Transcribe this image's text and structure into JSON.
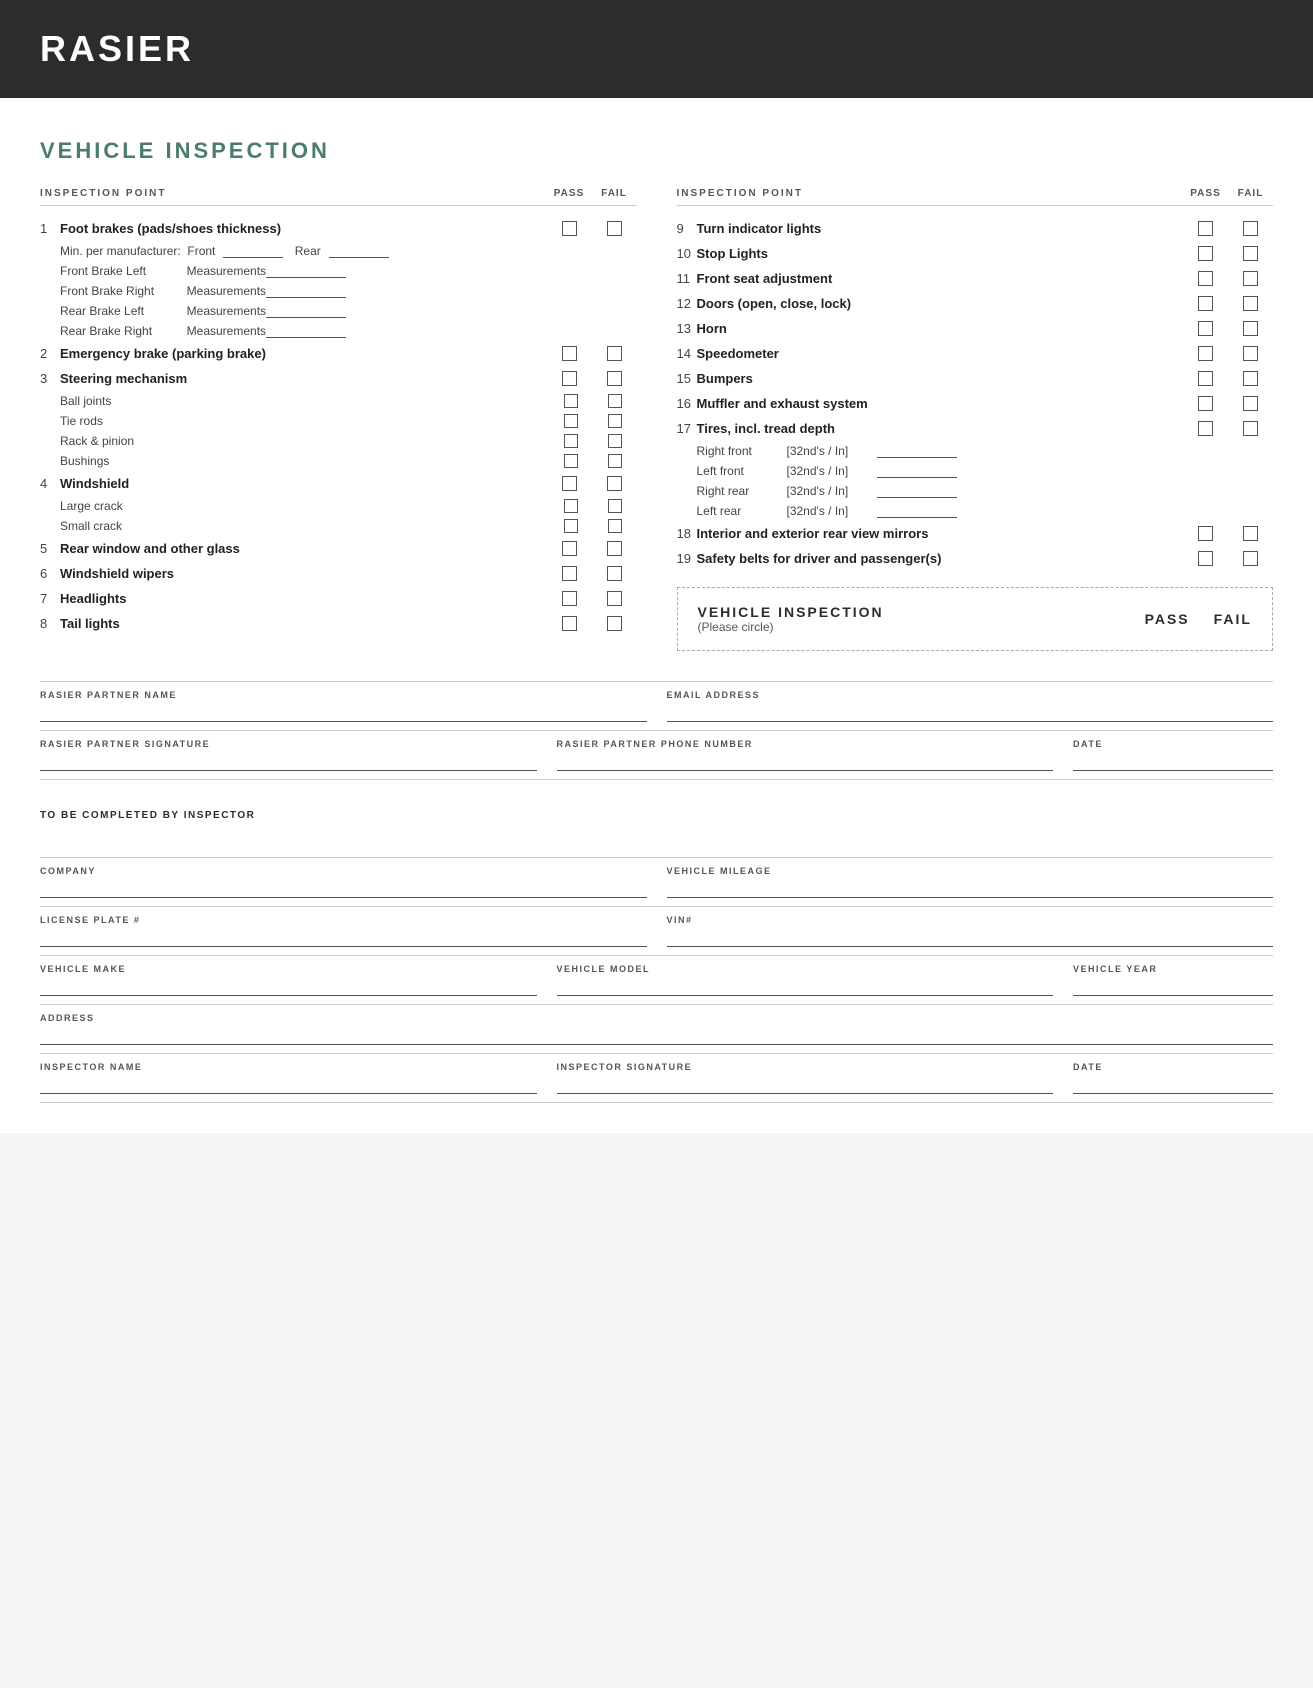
{
  "header": {
    "title": "RASIER"
  },
  "main": {
    "section_title": "VEHICLE INSPECTION",
    "col_headers": {
      "left": {
        "point": "INSPECTION POINT",
        "pass": "PASS",
        "fail": "FAIL"
      },
      "right": {
        "point": "INSPECTION POINT",
        "pass": "PASS",
        "fail": "FAIL"
      }
    },
    "left_items": [
      {
        "num": "1",
        "text": "Foot brakes (pads/shoes thickness)",
        "bold": true,
        "has_checkbox": true,
        "sub": [
          {
            "type": "min_per",
            "text": "Min. per manufacturer:",
            "front_label": "Front",
            "rear_label": "Rear"
          },
          {
            "type": "measurements",
            "label": "Front Brake Left",
            "meas": "Measurements"
          },
          {
            "type": "measurements",
            "label": "Front Brake Right",
            "meas": "Measurements"
          },
          {
            "type": "measurements",
            "label": "Rear Brake Left",
            "meas": "Measurements"
          },
          {
            "type": "measurements",
            "label": "Rear Brake Right",
            "meas": "Measurements"
          }
        ]
      },
      {
        "num": "2",
        "text": "Emergency brake (parking brake)",
        "bold": true,
        "has_checkbox": true
      },
      {
        "num": "3",
        "text": "Steering mechanism",
        "bold": true,
        "has_checkbox": true,
        "sub": [
          {
            "type": "checkbox_sub",
            "label": "Ball joints"
          },
          {
            "type": "checkbox_sub",
            "label": "Tie rods"
          },
          {
            "type": "checkbox_sub",
            "label": "Rack & pinion"
          },
          {
            "type": "checkbox_sub",
            "label": "Bushings"
          }
        ]
      },
      {
        "num": "4",
        "text": "Windshield",
        "bold": true,
        "has_checkbox": true,
        "sub": [
          {
            "type": "checkbox_sub",
            "label": "Large crack"
          },
          {
            "type": "checkbox_sub",
            "label": "Small crack"
          }
        ]
      },
      {
        "num": "5",
        "text": "Rear window and other glass",
        "bold": true,
        "has_checkbox": true
      },
      {
        "num": "6",
        "text": "Windshield wipers",
        "bold": true,
        "has_checkbox": true
      },
      {
        "num": "7",
        "text": "Headlights",
        "bold": true,
        "has_checkbox": true
      },
      {
        "num": "8",
        "text": "Tail lights",
        "bold": true,
        "has_checkbox": true
      }
    ],
    "right_items": [
      {
        "num": "9",
        "text": "Turn indicator lights",
        "bold": true,
        "has_checkbox": true
      },
      {
        "num": "10",
        "text": "Stop Lights",
        "bold": true,
        "has_checkbox": true
      },
      {
        "num": "11",
        "text": "Front seat adjustment",
        "bold": true,
        "has_checkbox": true
      },
      {
        "num": "12",
        "text": "Doors (open, close, lock)",
        "bold": true,
        "has_checkbox": true
      },
      {
        "num": "13",
        "text": "Horn",
        "bold": true,
        "has_checkbox": true
      },
      {
        "num": "14",
        "text": "Speedometer",
        "bold": true,
        "has_checkbox": true
      },
      {
        "num": "15",
        "text": "Bumpers",
        "bold": true,
        "has_checkbox": true
      },
      {
        "num": "16",
        "text": "Muffler and exhaust system",
        "bold": true,
        "has_checkbox": true
      },
      {
        "num": "17",
        "text": "Tires, incl. tread depth",
        "bold": true,
        "has_checkbox": true,
        "sub": [
          {
            "type": "tire",
            "label": "Right front",
            "unit": "[32nd's / In]"
          },
          {
            "type": "tire",
            "label": "Left front",
            "unit": "[32nd's / In]"
          },
          {
            "type": "tire",
            "label": "Right rear",
            "unit": "[32nd's / In]"
          },
          {
            "type": "tire",
            "label": "Left rear",
            "unit": "[32nd's / In]"
          }
        ]
      },
      {
        "num": "18",
        "text": "Interior and exterior rear view mirrors",
        "bold": true,
        "has_checkbox": true
      },
      {
        "num": "19",
        "text": "Safety belts for driver and passenger(s)",
        "bold": true,
        "has_checkbox": true
      }
    ],
    "dashed_box": {
      "title": "VEHICLE INSPECTION",
      "subtitle": "(Please circle)",
      "pass_label": "PASS",
      "fail_label": "FAIL"
    },
    "form": {
      "rows": [
        {
          "fields": [
            {
              "label": "RASIER PARTNER NAME",
              "line": true,
              "flex": 2
            },
            {
              "label": "EMAIL ADDRESS",
              "line": true,
              "flex": 2
            }
          ]
        },
        {
          "fields": [
            {
              "label": "RASIER PARTNER SIGNATURE",
              "line": true,
              "flex": 2
            },
            {
              "label": "RASIER PARTNER PHONE NUMBER",
              "line": true,
              "flex": 2
            },
            {
              "label": "DATE",
              "line": true,
              "flex": 1
            }
          ]
        }
      ],
      "inspector_header": "TO BE COMPLETED BY INSPECTOR",
      "inspector_rows": [
        {
          "fields": [
            {
              "label": "COMPANY",
              "line": true,
              "flex": 2
            },
            {
              "label": "VEHICLE MILEAGE",
              "line": true,
              "flex": 2
            }
          ]
        },
        {
          "fields": [
            {
              "label": "LICENSE PLATE #",
              "line": true,
              "flex": 2
            },
            {
              "label": "VIN#",
              "line": true,
              "flex": 2
            }
          ]
        },
        {
          "fields": [
            {
              "label": "VEHICLE MAKE",
              "line": true,
              "flex": 2
            },
            {
              "label": "VEHICLE MODEL",
              "line": true,
              "flex": 2
            },
            {
              "label": "VEHICLE YEAR",
              "line": true,
              "flex": 1
            }
          ]
        },
        {
          "fields": [
            {
              "label": "ADDRESS",
              "line": true,
              "flex": 4
            }
          ]
        },
        {
          "fields": [
            {
              "label": "INSPECTOR NAME",
              "line": true,
              "flex": 2
            },
            {
              "label": "INSPECTOR SIGNATURE",
              "line": true,
              "flex": 2
            },
            {
              "label": "DATE",
              "line": true,
              "flex": 1
            }
          ]
        }
      ]
    }
  }
}
